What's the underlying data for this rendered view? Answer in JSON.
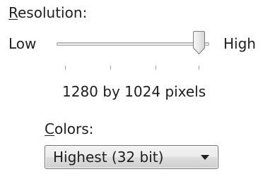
{
  "resolution": {
    "label_mnemonic": "R",
    "label_rest": "esolution:",
    "low_label": "Low",
    "high_label": "High",
    "value_text": "1280 by 1024 pixels",
    "slider_position": 0.93
  },
  "colors": {
    "label_mnemonic": "C",
    "label_rest": "olors:",
    "selected": "Highest (32 bit)"
  },
  "theme": {
    "text": "#1e1e1e",
    "track_border": "#a8a8a8",
    "tick": "#a6a6a6",
    "dropdown_border": "#707070"
  }
}
